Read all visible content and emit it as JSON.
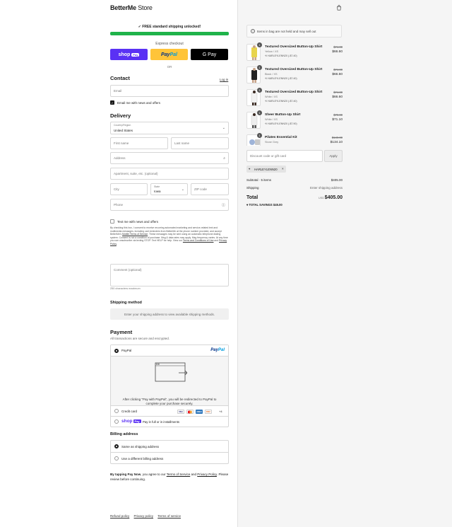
{
  "brand": {
    "name_bold": "BetterMe",
    "name_regular": " Store"
  },
  "shipping_banner": {
    "text": "✓ FREE standard shipping unlocked!",
    "progress": 1.0
  },
  "express": {
    "label": "Express checkout",
    "shop_label": "shop",
    "shop_pay": "Pay",
    "paypal_a": "Pay",
    "paypal_b": "Pal",
    "gpay_label": "G Pay",
    "or_label": "OR"
  },
  "contact": {
    "heading": "Contact",
    "login_label": "Log in",
    "email_placeholder": "Email",
    "news_label": "Email me with news and offers"
  },
  "delivery": {
    "heading": "Delivery",
    "country_label": "Country/Region",
    "country_value": "United States",
    "first_name": "First name",
    "last_name": "Last name",
    "address": "Address",
    "apartment": "Apartment, suite, etc. (optional)",
    "city": "City",
    "state_label": "State",
    "state_value": "Iowa",
    "zip": "ZIP code",
    "phone": "Phone",
    "text_news_label": "Text me with news and offers",
    "fine_print_a": "By checking this box, I consent to receive recurring automated marketing and service-related text and multimedia messages, including cart reminders from BetterMe at the phone number provided, and accept BetterMe's ",
    "fine_link_1": "Mobile Terms of Service",
    "fine_print_b": ". These messages may be sent using an automatic telephone dialing system. Consent is not a condition of purchase. Msg & data rates may apply. Msg frequency varies. At any time you can unsubscribe via texting STOP. Text HELP for help. View our ",
    "fine_link_2": "Terms and Conditions of Use",
    "fine_print_c": " and ",
    "fine_link_3": "Privacy Policy",
    "fine_print_d": ".",
    "comment_placeholder": "Comment (optional)",
    "char_limit": "250 characters maximum"
  },
  "shipping_method": {
    "heading": "Shipping method",
    "placeholder": "Enter your shipping address to view available shipping methods."
  },
  "payment": {
    "heading": "Payment",
    "subtext": "All transactions are secure and encrypted.",
    "paypal_label": "PayPal",
    "paypal_logo_a": "Pay",
    "paypal_logo_b": "Pal",
    "redirect_text": "After clicking \"Pay with PayPal\", you will be redirected to PayPal to complete your purchase securely.",
    "credit_label": "Credit card",
    "cards": [
      "VISA",
      "MC",
      "AMEX",
      "DISC"
    ],
    "more_cards": "+4",
    "shoppay_label": "shop",
    "shoppay_badge": "Pay",
    "shoppay_text": "Pay in full or in installments"
  },
  "billing": {
    "heading": "Billing address",
    "same": "Same as shipping address",
    "different": "Use a different billing address"
  },
  "terms": {
    "bold": "By tapping Pay Now",
    "text_a": ", you agree to our ",
    "link_1": "Terms of Service",
    "text_b": " and ",
    "link_2": "Privacy Policy",
    "text_c": ". Please review before continuing."
  },
  "footer": {
    "refund": "Refund policy",
    "privacy": "Privacy policy",
    "tos": "Terms of service"
  },
  "cart": {
    "notice": "Items in bag are not held and may sell out",
    "items": [
      {
        "qty": "1",
        "name": "Textured Oversized Button-Up Shirt",
        "variant": "Yellow / XS",
        "code": "HARLEYLENN20 (-$7.40)",
        "old": "$74.00",
        "new": "$66.60",
        "color": "#e8d44d"
      },
      {
        "qty": "1",
        "name": "Textured Oversized Button-Up Shirt",
        "variant": "Black / XS",
        "code": "HARLEYLENN20 (-$7.40)",
        "old": "$74.00",
        "new": "$66.60",
        "color": "#222222"
      },
      {
        "qty": "1",
        "name": "Textured Oversized Button-Up Shirt",
        "variant": "White / XS",
        "code": "HARLEYLENN20 (-$7.40)",
        "old": "$74.00",
        "new": "$66.60",
        "color": "#f2f2f2"
      },
      {
        "qty": "1",
        "name": "Sheer Button-Up Shirt",
        "variant": "White / XS",
        "code": "HARLEYLENN20 (-$7.90)",
        "old": "$79.00",
        "new": "$71.10",
        "color": "#eeeeee"
      },
      {
        "qty": "1",
        "name": "Pilates Essential Kit",
        "variant": "Stone Grey",
        "code": "",
        "old": "$149.00",
        "new": "$134.10",
        "color": "#c9c9c9"
      }
    ],
    "discount_placeholder": "Discount code or gift card",
    "apply_label": "Apply",
    "applied_code": "HARLEYLENN20",
    "subtotal_label": "Subtotal · 5 items",
    "subtotal_value": "$405.00",
    "shipping_label": "Shipping",
    "shipping_value": "Enter shipping address",
    "total_label": "Total",
    "currency": "USD",
    "total_value": "$405.00",
    "savings_label": "TOTAL SAVINGS",
    "savings_value": "$45.00"
  },
  "colors": {
    "shop": "#5a31f4",
    "paypal": "#ffc439",
    "progress": "#1fb34a",
    "summary_bg": "#f5f5f5"
  }
}
